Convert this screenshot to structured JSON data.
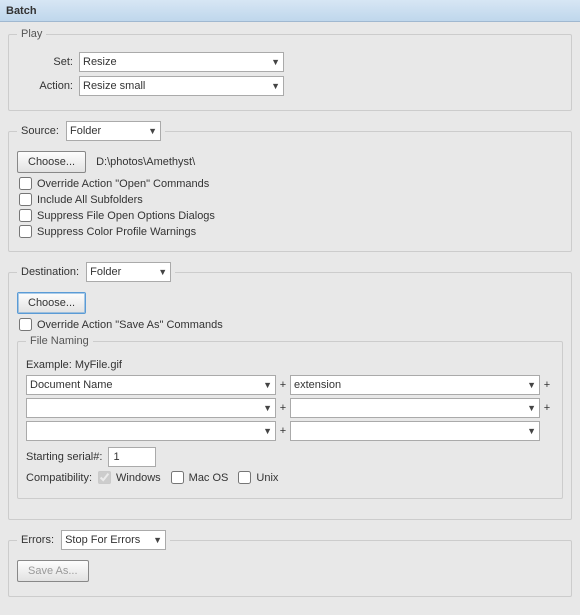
{
  "title": "Batch",
  "play": {
    "legend": "Play",
    "set_label": "Set:",
    "set_value": "Resize",
    "action_label": "Action:",
    "action_value": "Resize small"
  },
  "source": {
    "label": "Source:",
    "value": "Folder",
    "choose": "Choose...",
    "path": "D:\\photos\\Amethyst\\",
    "opts": [
      "Override Action \"Open\" Commands",
      "Include All Subfolders",
      "Suppress File Open Options Dialogs",
      "Suppress Color Profile Warnings"
    ]
  },
  "dest": {
    "label": "Destination:",
    "value": "Folder",
    "choose": "Choose...",
    "override": "Override Action \"Save As\" Commands",
    "naming_legend": "File Naming",
    "example_label": "Example:",
    "example_value": "MyFile.gif",
    "fields": [
      "Document Name",
      "extension",
      "",
      "",
      "",
      ""
    ],
    "starting_label": "Starting serial#:",
    "starting_value": "1",
    "compat_label": "Compatibility:",
    "compat_win": "Windows",
    "compat_mac": "Mac OS",
    "compat_unix": "Unix"
  },
  "errors": {
    "label": "Errors:",
    "value": "Stop For Errors",
    "saveas": "Save As..."
  }
}
